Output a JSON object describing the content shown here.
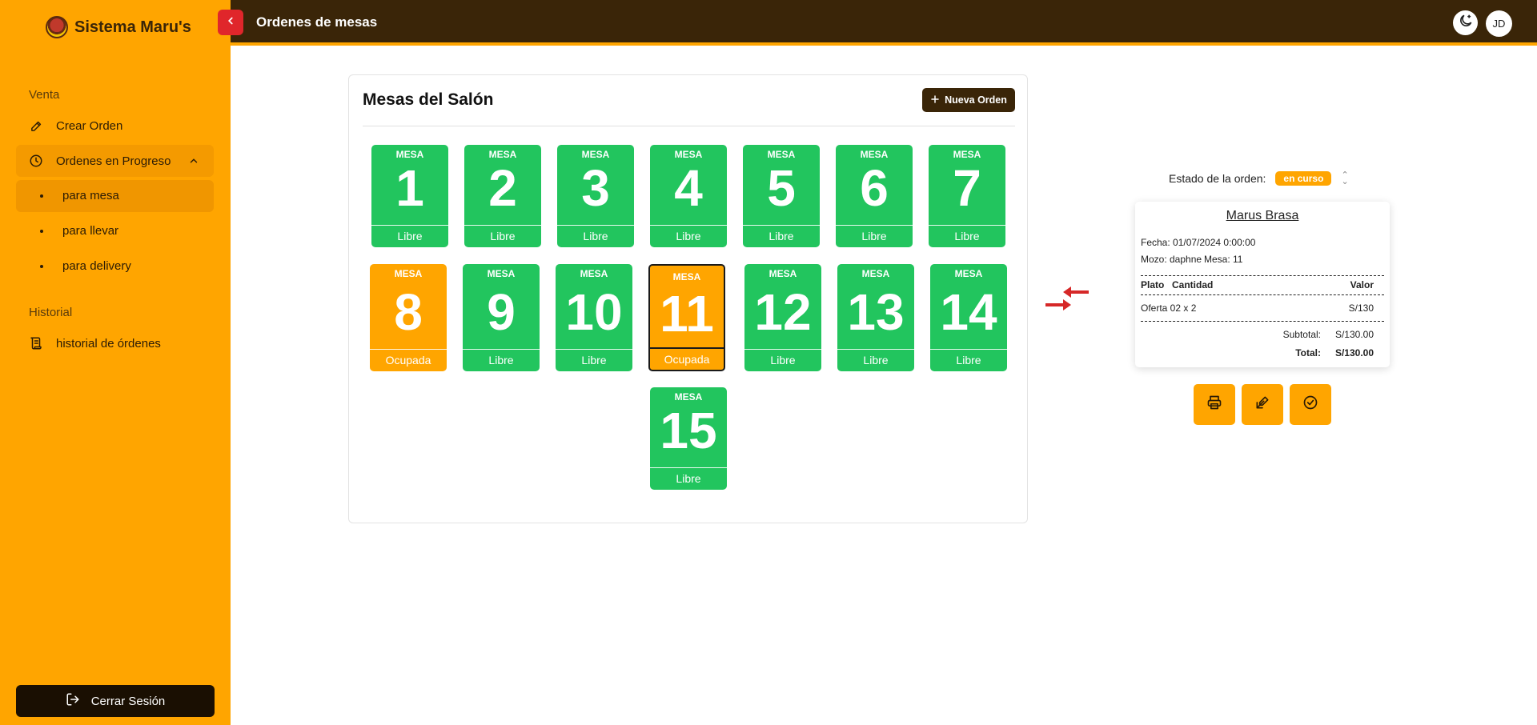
{
  "app": {
    "brand": "Sistema Maru's"
  },
  "sidebar": {
    "section_venta": "Venta",
    "crear_orden": "Crear Orden",
    "ordenes_progreso": "Ordenes en Progreso",
    "sub_items": [
      "para mesa",
      "para llevar",
      "para delivery"
    ],
    "section_historial": "Historial",
    "historial": "historial de órdenes",
    "logout": "Cerrar Sesión"
  },
  "header": {
    "title": "Ordenes de mesas",
    "avatar": "JD"
  },
  "salon": {
    "title": "Mesas del Salón",
    "new_order": "Nueva Orden",
    "table_label": "MESA",
    "tables": [
      {
        "num": "1",
        "state": "Libre"
      },
      {
        "num": "2",
        "state": "Libre"
      },
      {
        "num": "3",
        "state": "Libre"
      },
      {
        "num": "4",
        "state": "Libre"
      },
      {
        "num": "5",
        "state": "Libre"
      },
      {
        "num": "6",
        "state": "Libre"
      },
      {
        "num": "7",
        "state": "Libre"
      },
      {
        "num": "8",
        "state": "Ocupada"
      },
      {
        "num": "9",
        "state": "Libre"
      },
      {
        "num": "10",
        "state": "Libre"
      },
      {
        "num": "11",
        "state": "Ocupada"
      },
      {
        "num": "12",
        "state": "Libre"
      },
      {
        "num": "13",
        "state": "Libre"
      },
      {
        "num": "14",
        "state": "Libre"
      },
      {
        "num": "15",
        "state": "Libre"
      }
    ]
  },
  "order": {
    "status_label": "Estado de la orden:",
    "status_value": "en curso",
    "restaurant": "Marus Brasa",
    "fecha": "Fecha: 01/07/2024 0:00:00",
    "mozo": "Mozo: daphne",
    "mesa": "Mesa: 11",
    "col_plato": "Plato",
    "col_cantidad": "Cantidad",
    "col_valor": "Valor",
    "item_name": "Oferta 02 x 2",
    "item_value": "S/130",
    "subtotal_label": "Subtotal:",
    "subtotal_value": "S/130.00",
    "total_label": "Total:",
    "total_value": "S/130.00"
  },
  "colors": {
    "accent": "#ffa500",
    "header": "#3a2508",
    "libre": "#22c55e",
    "danger": "#e0262b"
  }
}
